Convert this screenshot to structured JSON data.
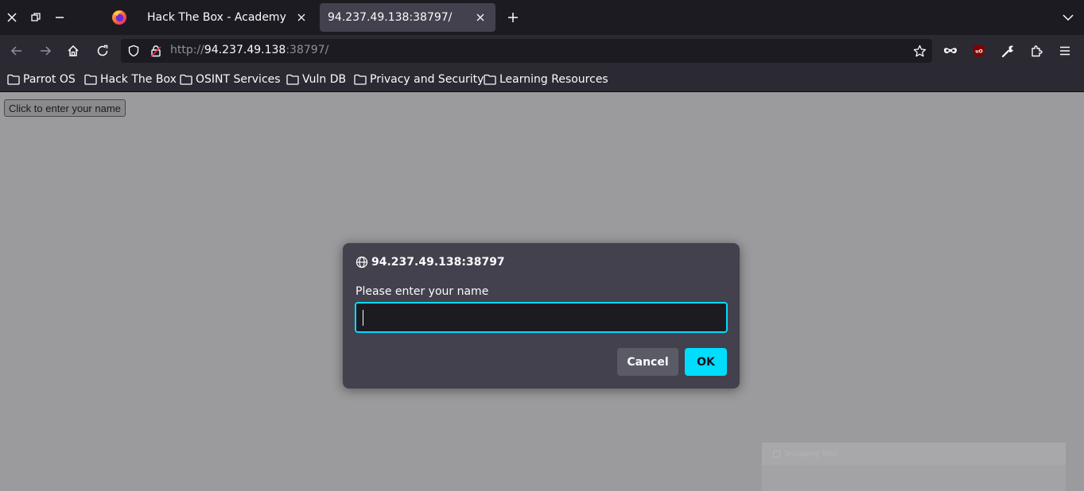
{
  "window_controls": [
    "close-icon",
    "restore-icon",
    "minimize-icon"
  ],
  "tabs": [
    {
      "title": "Hack The Box - Academy",
      "active": false
    },
    {
      "title": "94.237.49.138:38797/",
      "active": true
    }
  ],
  "urlbar": {
    "scheme": "http://",
    "host": "94.237.49.138",
    "port_path": ":38797/"
  },
  "bookmarks": [
    {
      "label": "Parrot OS"
    },
    {
      "label": "Hack The Box"
    },
    {
      "label": "OSINT Services"
    },
    {
      "label": "Vuln DB"
    },
    {
      "label": "Privacy and Security"
    },
    {
      "label": "Learning Resources"
    }
  ],
  "page": {
    "button_label": "Click to enter your name"
  },
  "dialog": {
    "origin": "94.237.49.138:38797",
    "message": "Please enter your name",
    "input_value": "",
    "cancel_label": "Cancel",
    "ok_label": "OK"
  },
  "snipping_tool": {
    "title": "Snipping Tool"
  },
  "colors": {
    "accent": "#00ddff",
    "tab_bar": "#1c1b22",
    "toolbar": "#2b2a33",
    "dialog": "#42414d",
    "ublock_red": "#800000"
  }
}
